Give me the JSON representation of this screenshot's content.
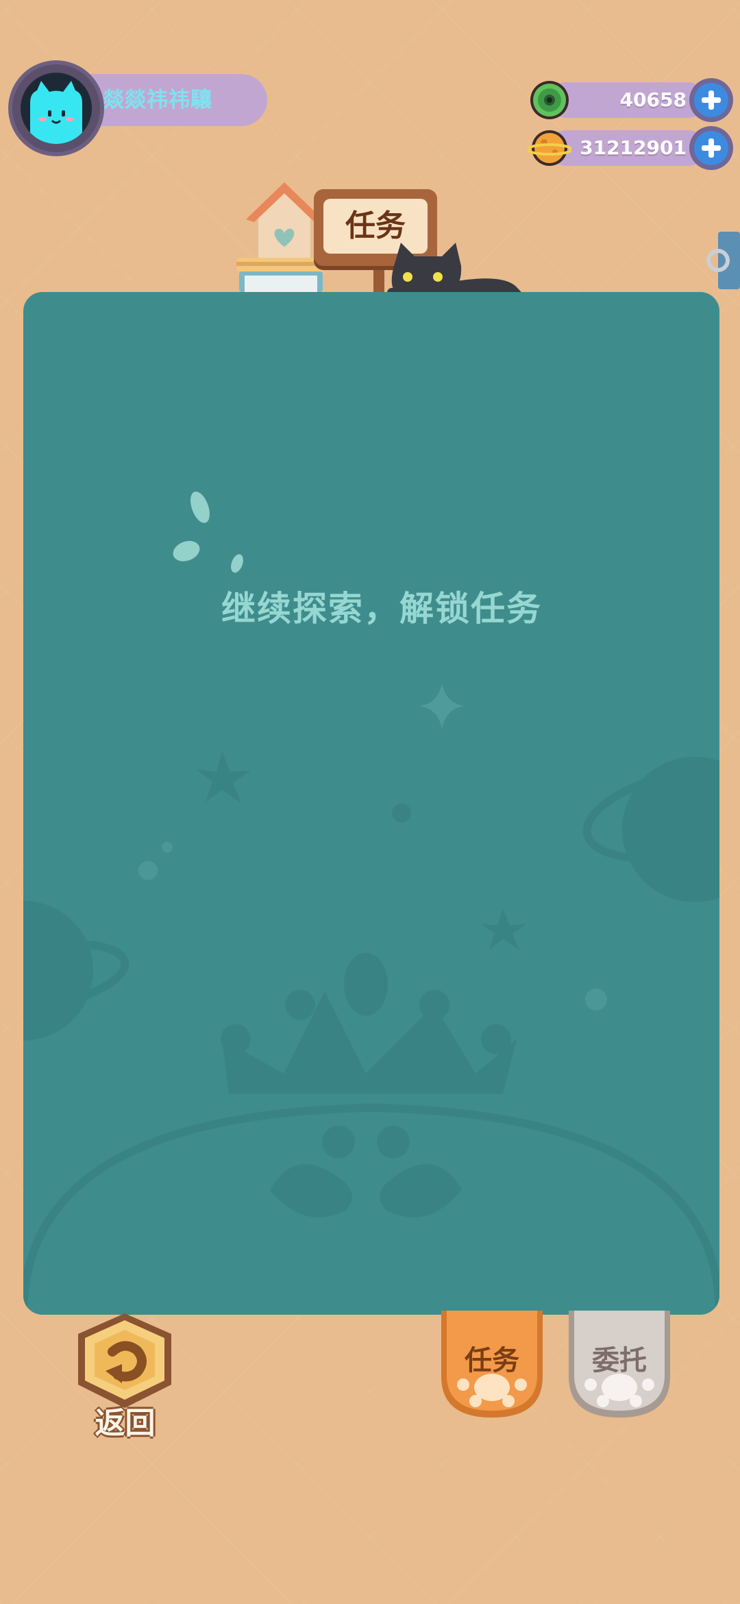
{
  "player": {
    "name": "燚燚祎祎驤",
    "avatar_icon": "cat-face-icon"
  },
  "currency": [
    {
      "icon": "green-donut-coin-icon",
      "value": "40658"
    },
    {
      "icon": "planet-coin-icon",
      "value": "31212901"
    }
  ],
  "header": {
    "sign_label": "任务"
  },
  "panel": {
    "empty_message": "继续探索，解锁任务"
  },
  "bottom": {
    "back_label": "返回",
    "tabs": [
      {
        "label": "任务",
        "active": true
      },
      {
        "label": "委托",
        "active": false
      }
    ]
  },
  "colors": {
    "background": "#e8bc8e",
    "panel": "#3f8c8d",
    "bar": "#c2a6d2",
    "active_tab": "#f29a4a",
    "inactive_tab": "#d7cfca"
  }
}
